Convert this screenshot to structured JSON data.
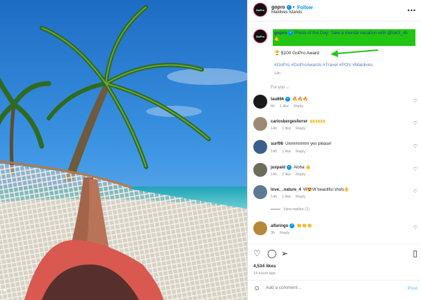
{
  "post": {
    "user_tag_icon": "person-icon",
    "author": "gopro",
    "follow_label": "Follow",
    "location": "Maldives Islands",
    "more_icon": "more-icon",
    "caption": {
      "author": "gopro",
      "text": "Photo of the Day: Take a mental vacation with @luk3_vb ",
      "award": "$100 GoPro Award",
      "hashtags": "#GoPro #GoProAwards #Travel #POV #Maldives",
      "time": "14h",
      "highlight_color": "#22c514",
      "arrow_color": "#22c514"
    },
    "for_you": "For you",
    "comments": [
      {
        "user": "tau666",
        "verified": true,
        "text": "🔥🔥🔥",
        "time": "6h",
        "likes": "1 like",
        "reply": "Reply",
        "avatar_color": "#1a1a1a"
      },
      {
        "user": "carlosbergesferrer",
        "verified": false,
        "text": "🙌🙌🙌",
        "time": "14h",
        "likes": "1 like",
        "reply": "Reply",
        "avatar_color": "#9a8b74"
      },
      {
        "user": "surf06",
        "verified": false,
        "text": "Ummmmmm yes please!",
        "time": "14h",
        "likes": "1 like",
        "reply": "Reply",
        "avatar_color": "#3a5f8a"
      },
      {
        "user": "juxpaid",
        "verified": true,
        "text": "Aloha 🤙",
        "time": "14h",
        "likes": "1 like",
        "reply": "Reply",
        "avatar_color": "#6d6d5b"
      },
      {
        "user": "love._.nature_4",
        "verified": false,
        "text": "W😍W beautiful shots✋",
        "time": "14h",
        "likes": "1 like",
        "reply": "Reply",
        "avatar_color": "#5c7a93"
      },
      {
        "user": "alfaringo",
        "verified": true,
        "text": "👏👏👏",
        "time": "3h",
        "likes": "",
        "reply": "Reply",
        "avatar_color": "#b5883a"
      }
    ],
    "view_replies": "View replies (1)",
    "likes": "4,534 likes",
    "posted": "14 hours ago",
    "add_comment_placeholder": "Add a comment...",
    "post_label": "Post"
  }
}
